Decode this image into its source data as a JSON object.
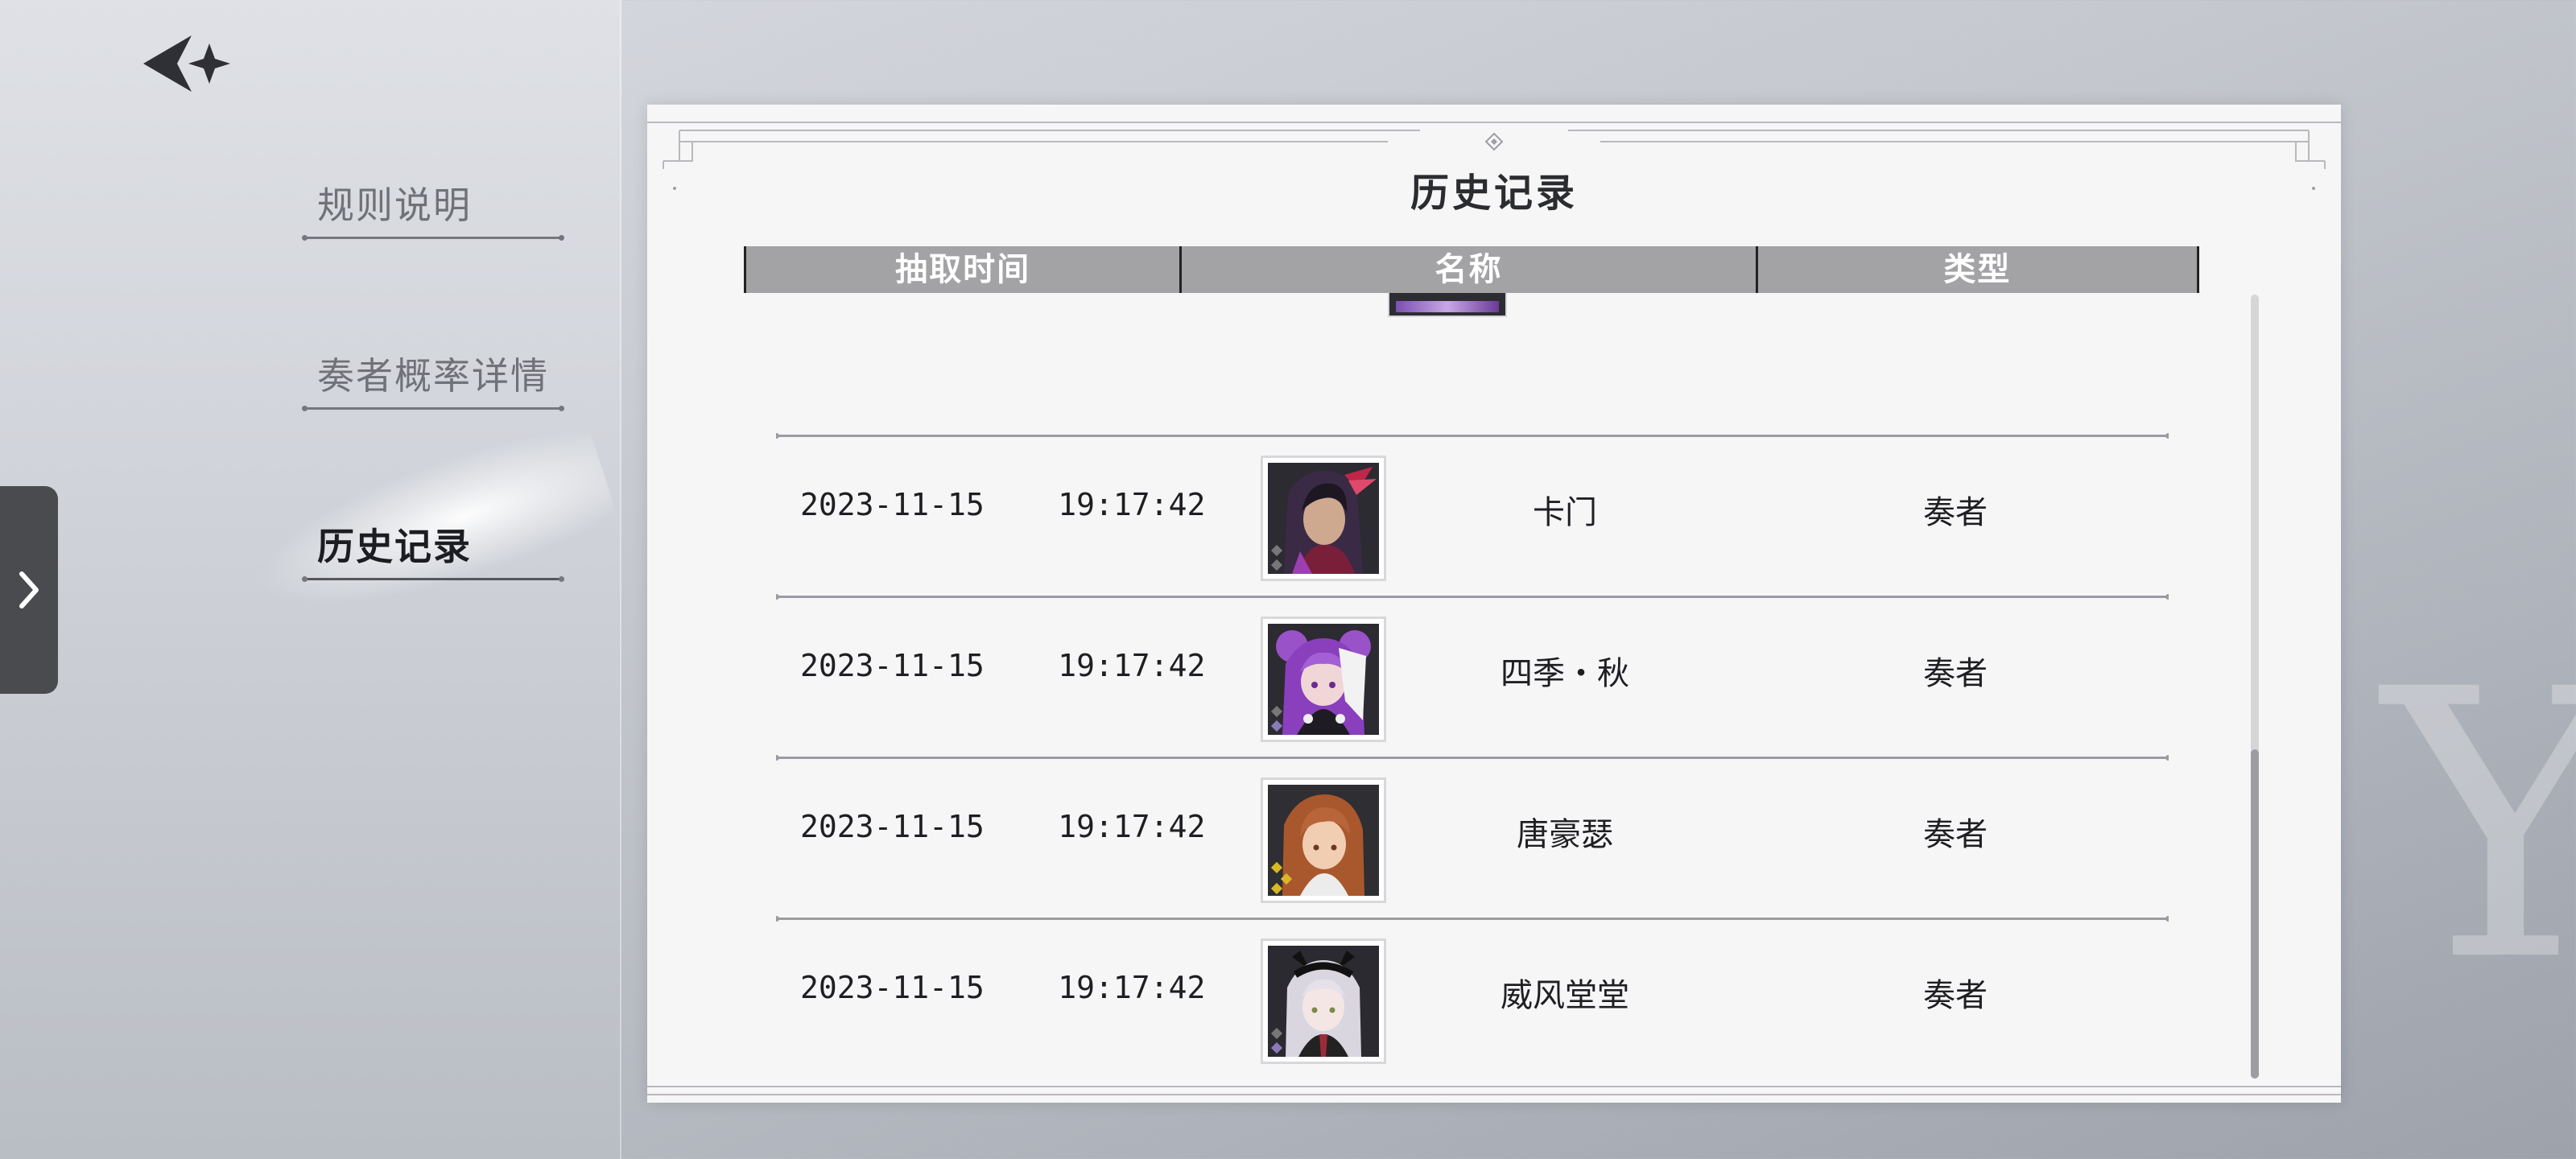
{
  "sidebar": {
    "menu": [
      {
        "label": "规则说明",
        "active": false
      },
      {
        "label": "奏者概率详情",
        "active": false
      },
      {
        "label": "历史记录",
        "active": true
      }
    ]
  },
  "panel": {
    "title": "历史记录",
    "columns": [
      "抽取时间",
      "名称",
      "类型"
    ],
    "rows": [
      {
        "date": "2023-11-15",
        "time": "19:17:42",
        "name": "卡门",
        "type": "奏者",
        "avatar": "carmen-portrait"
      },
      {
        "date": "2023-11-15",
        "time": "19:17:42",
        "name": "四季・秋",
        "type": "奏者",
        "avatar": "four-seasons-autumn-portrait"
      },
      {
        "date": "2023-11-15",
        "time": "19:17:42",
        "name": "唐豪瑟",
        "type": "奏者",
        "avatar": "tannhauser-portrait"
      },
      {
        "date": "2023-11-15",
        "time": "19:17:42",
        "name": "威风堂堂",
        "type": "奏者",
        "avatar": "pomp-and-circumstance-portrait"
      }
    ],
    "scroll_position": 0.58
  },
  "colors": {
    "header_bg": "#a3a3a5",
    "panel_bg": "#f6f6f7",
    "active_text": "#1c1d22",
    "inactive_text": "#707278"
  }
}
